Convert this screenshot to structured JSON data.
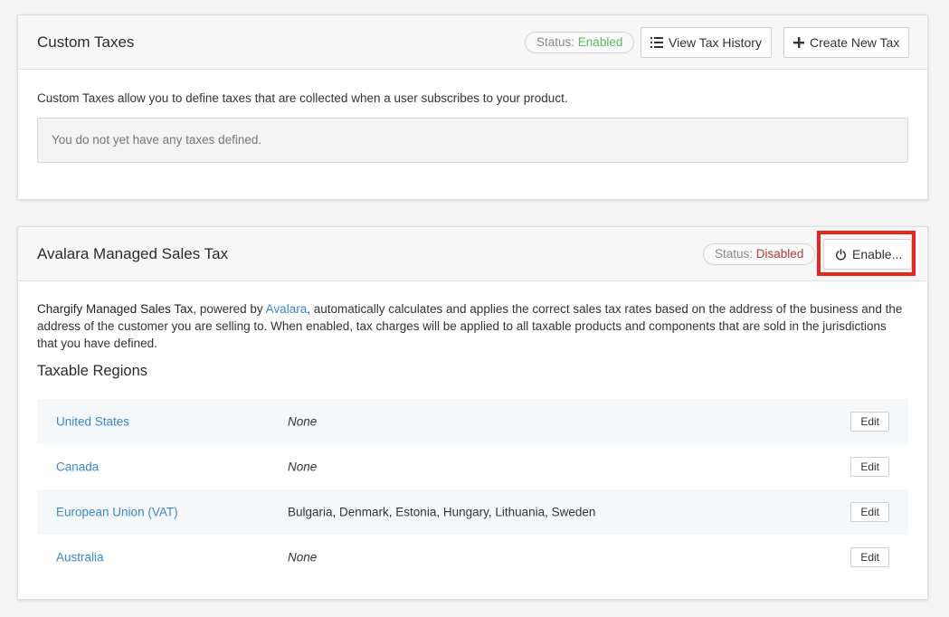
{
  "custom_taxes": {
    "title": "Custom Taxes",
    "status_label": "Status:",
    "status_value": "Enabled",
    "view_history_label": "View Tax History",
    "create_label": "Create New Tax",
    "description": "Custom Taxes allow you to define taxes that are collected when a user subscribes to your product.",
    "empty_message": "You do not yet have any taxes defined."
  },
  "avalara": {
    "title": "Avalara Managed Sales Tax",
    "status_label": "Status:",
    "status_value": "Disabled",
    "enable_label": "Enable...",
    "desc_bold": "Chargify Managed Sales Tax",
    "desc_mid": ", powered by ",
    "desc_link": "Avalara",
    "desc_rest": ", automatically calculates and applies the correct sales tax rates based on the address of the business and the address of the customer you are selling to. When enabled, tax charges will be applied to all taxable products and components that are sold in the jurisdictions that you have defined.",
    "regions_title": "Taxable Regions",
    "edit_label": "Edit",
    "regions": [
      {
        "name": "United States",
        "value": "None"
      },
      {
        "name": "Canada",
        "value": "None"
      },
      {
        "name": "European Union (VAT)",
        "value": "Bulgaria, Denmark, Estonia, Hungary, Lithuania, Sweden"
      },
      {
        "name": "Australia",
        "value": "None"
      }
    ]
  },
  "icons": {
    "list": "list-icon",
    "plus": "plus-icon",
    "power": "power-icon"
  },
  "colors": {
    "enabled": "#5cb85c",
    "disabled": "#b03a3a",
    "link": "#3a87c8",
    "highlight": "#e8261c"
  }
}
